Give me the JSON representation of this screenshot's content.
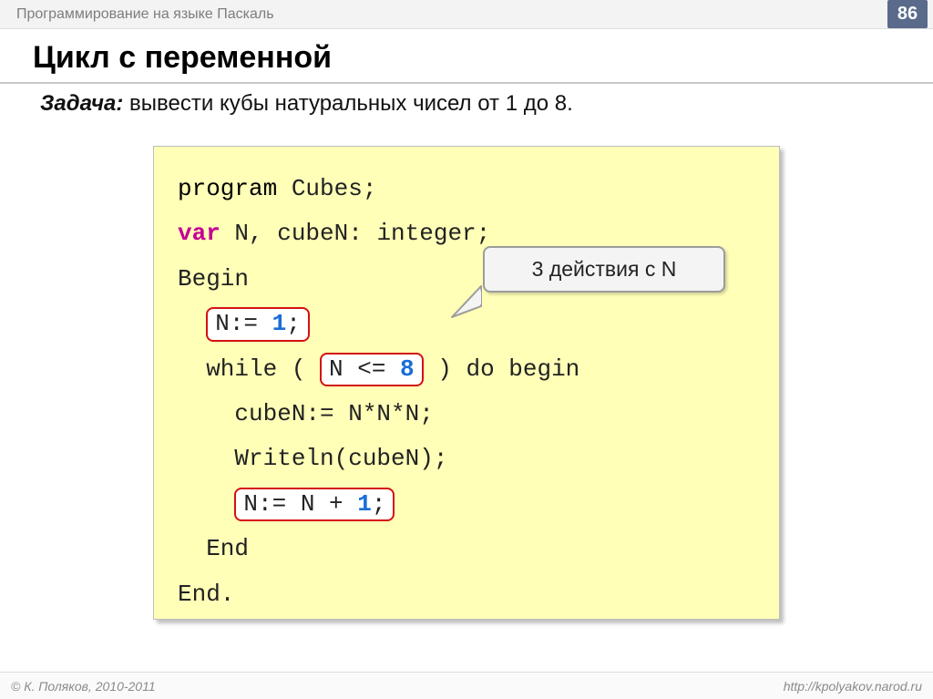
{
  "topbar": {
    "title": "Программирование на языке Паскаль",
    "page_number": "86"
  },
  "heading": "Цикл с переменной",
  "task": {
    "label": "Задача:",
    "italic_part": " вывести кубы натуральных чисел от 1 до 8."
  },
  "code": {
    "line1_a": "program",
    "line1_b": " Cubes;",
    "line2_var": "var",
    "line2_rest": " N, cubeN: integer;",
    "line3": "Begin",
    "line4_pre": "  ",
    "line4_hl_a": "N:= ",
    "line4_hl_num": "1",
    "line4_hl_b": ";",
    "line5_a": "  while ( ",
    "line5_hl_a": "N <= ",
    "line5_hl_num": "8",
    "line5_b": " ) do begin",
    "line6": "    cubeN:= N*N*N;",
    "line7": "    Writeln(cubeN);",
    "line8_pre": "    ",
    "line8_hl_a": "N:= N + ",
    "line8_hl_num": "1",
    "line8_hl_b": ";",
    "line9": "  End",
    "line10": "End."
  },
  "callout": {
    "text": "3 действия с N"
  },
  "footer": {
    "left": "© К. Поляков, 2010-2011",
    "right": "http://kpolyakov.narod.ru"
  }
}
